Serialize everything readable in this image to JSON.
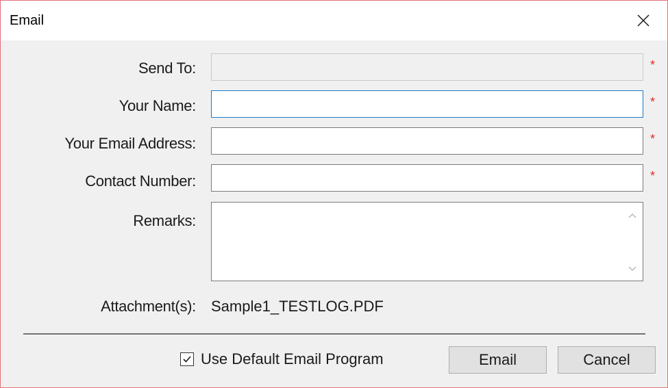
{
  "window": {
    "title": "Email"
  },
  "form": {
    "send_to": {
      "label": "Send To:",
      "value": "",
      "required_mark": "*"
    },
    "your_name": {
      "label": "Your Name:",
      "value": "",
      "required_mark": "*"
    },
    "your_email": {
      "label": "Your Email Address:",
      "value": "",
      "required_mark": "*"
    },
    "contact_number": {
      "label": "Contact Number:",
      "value": "",
      "required_mark": "*"
    },
    "remarks": {
      "label": "Remarks:",
      "value": ""
    },
    "attachments": {
      "label": "Attachment(s):",
      "value": "Sample1_TESTLOG.PDF"
    }
  },
  "footer": {
    "use_default_checkbox": {
      "label": "Use Default Email Program",
      "checked": true
    },
    "email_button": "Email",
    "cancel_button": "Cancel"
  },
  "icons": {
    "close": "close-icon",
    "scroll_up": "chevron-up-icon",
    "scroll_down": "chevron-down-icon",
    "checkmark": "checkmark-icon"
  },
  "colors": {
    "required_star": "#e0262a",
    "focus_border": "#1979ca",
    "window_border": "#e0707a"
  }
}
